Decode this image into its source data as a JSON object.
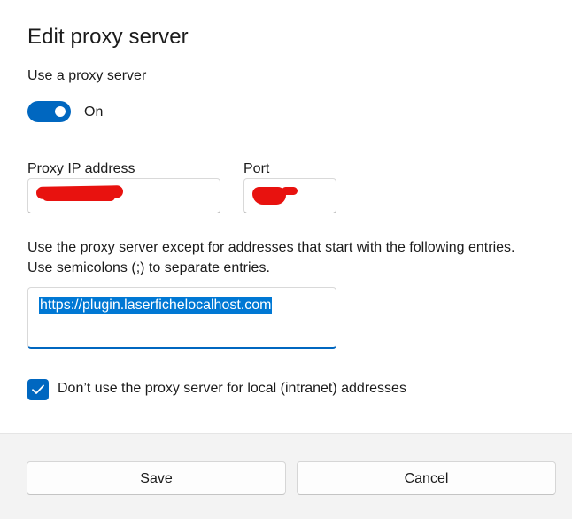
{
  "dialog": {
    "title": "Edit proxy server",
    "use_proxy_label": "Use a proxy server",
    "toggle": {
      "state_label": "On",
      "checked": true
    },
    "proxy_ip": {
      "label": "Proxy IP address",
      "value": ""
    },
    "port": {
      "label": "Port",
      "value": ""
    },
    "exceptions": {
      "description_line1": "Use the proxy server except for addresses that start with the following entries.",
      "description_line2": "Use semicolons (;) to separate entries.",
      "value": "https://plugin.laserfichelocalhost.com"
    },
    "local_bypass": {
      "label": "Don’t use the proxy server for local (intranet) addresses",
      "checked": true
    },
    "buttons": {
      "save": "Save",
      "cancel": "Cancel"
    }
  },
  "colors": {
    "accent": "#0067c0",
    "selection": "#0078d4",
    "redaction": "#e8120f",
    "footer_bg": "#f3f3f3"
  }
}
